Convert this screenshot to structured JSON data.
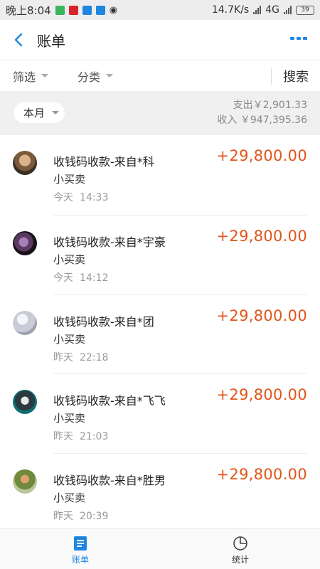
{
  "status_bar": {
    "time": "晚上8:04",
    "net_speed": "14.7K/s",
    "network": "4G",
    "battery": "39"
  },
  "header": {
    "title": "账单"
  },
  "filters": {
    "filter_label": "筛选",
    "category_label": "分类",
    "search_label": "搜索"
  },
  "month_bar": {
    "month_label": "本月",
    "expense_text": "支出￥2,901.33",
    "income_text": "收入 ￥947,395.36"
  },
  "transactions": [
    {
      "title": "收钱码收款-来自*科",
      "sub": "小买卖",
      "day": "今天",
      "time": "14:33",
      "amount": "+29,800.00"
    },
    {
      "title": "收钱码收款-来自*宇豪",
      "sub": "小买卖",
      "day": "今天",
      "time": "14:12",
      "amount": "+29,800.00"
    },
    {
      "title": "收钱码收款-来自*团",
      "sub": "小买卖",
      "day": "昨天",
      "time": "22:18",
      "amount": "+29,800.00"
    },
    {
      "title": "收钱码收款-来自*飞飞",
      "sub": "小买卖",
      "day": "昨天",
      "time": "21:03",
      "amount": "+29,800.00"
    },
    {
      "title": "收钱码收款-来自*胜男",
      "sub": "小买卖",
      "day": "昨天",
      "time": "20:39",
      "amount": "+29,800.00"
    }
  ],
  "bottom_nav": {
    "bill_label": "账单",
    "stats_label": "统计"
  },
  "colors": {
    "accent_blue": "#1f86e0",
    "amount_orange": "#e25518"
  }
}
